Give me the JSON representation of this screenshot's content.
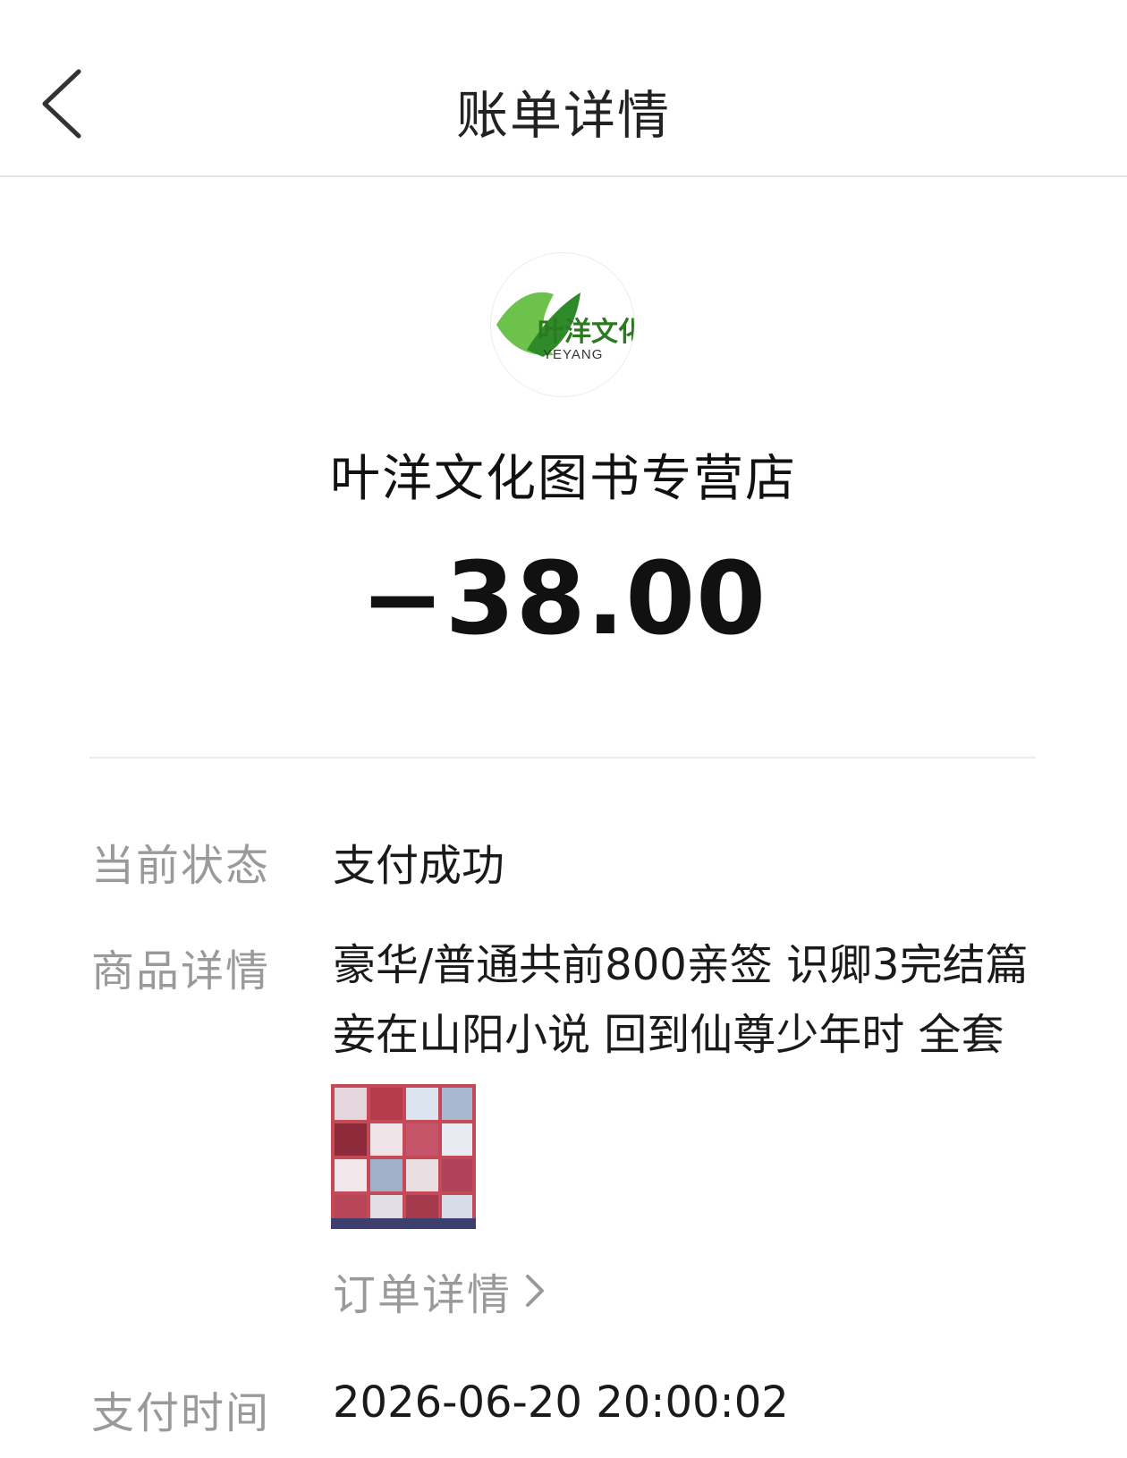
{
  "nav": {
    "title": "账单详情"
  },
  "merchant": {
    "name": "叶洋文化图书专营店",
    "logo_text": "叶洋文化",
    "logo_subtext": "YEYANG"
  },
  "amount": "−38.00",
  "rows": {
    "status_label": "当前状态",
    "status_value": "支付成功",
    "product_label": "商品详情",
    "product_value": "豪华/普通共前800亲签 识卿3完结篇 妾在山阳小说 回到仙尊少年时 全套",
    "order_detail_link": "订单详情",
    "pay_time_label": "支付时间",
    "pay_time_value": "2026-06-20 20:00:02"
  },
  "colors": {
    "accent_green": "#4a9d2e",
    "label_gray": "#9a9a9a",
    "text_dark": "#1a1a1a"
  },
  "icons": {
    "back": "chevron-left-icon",
    "order_detail": "chevron-right-icon"
  }
}
